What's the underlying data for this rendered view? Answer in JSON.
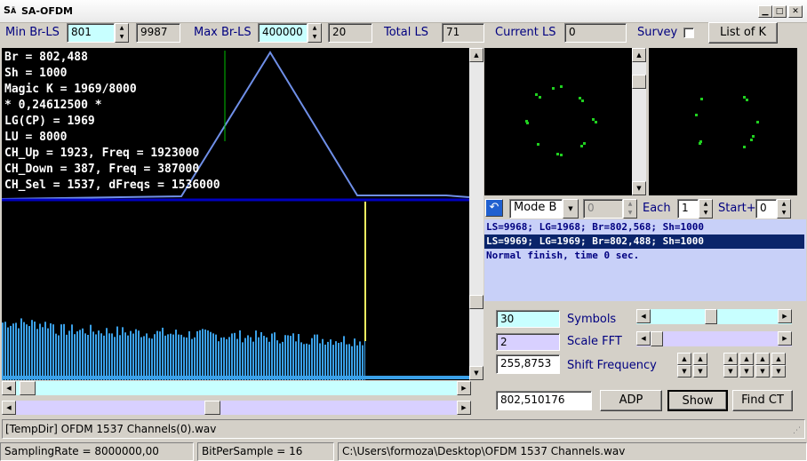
{
  "window": {
    "title": "SA-OFDM",
    "app_icon": "sa-icon",
    "controls": [
      "minimize",
      "maximize",
      "close"
    ]
  },
  "toolbar": {
    "min_br_label": "Min Br-LS",
    "min_br_value": "801",
    "min_br_aux": "9987",
    "max_br_label": "Max Br-LS",
    "max_br_value": "400000",
    "max_br_aux": "20",
    "total_ls_label": "Total LS",
    "total_ls_value": "71",
    "current_ls_label": "Current LS",
    "current_ls_value": "0",
    "survey_label": "Survey",
    "survey_checked": false,
    "list_of_k_label": "List of K"
  },
  "plot": {
    "info_lines": [
      "Br = 802,488",
      "Sh = 1000",
      "Magic K = 1969/8000",
      "* 0,24612500 *",
      "LG(CP) = 1969",
      "LU = 8000",
      "CH_Up = 1923, Freq = 1923000",
      "CH_Down = 387, Freq = 387000",
      "CH_Sel = 1537, dFreqs = 1536000"
    ],
    "colors": {
      "triangle": "#6f8fe8",
      "marker_green": "#00c000",
      "divider": "#0000c0",
      "marker_yellow": "#f0f060",
      "spectrum": "#3aa0e8"
    }
  },
  "mode_bar": {
    "mode_value": "Mode B",
    "step_value": "0",
    "each_label": "Each",
    "each_value": "1",
    "start_label": "Start+",
    "start_value": "0"
  },
  "log": {
    "lines": [
      "LS=9968; LG=1968; Br=802,568; Sh=1000",
      "LS=9969; LG=1969; Br=802,488; Sh=1000",
      "Normal finish, time 0 sec."
    ],
    "selected_index": 1
  },
  "controls": {
    "symbols_value": "30",
    "symbols_label": "Symbols",
    "symbols_slider_fraction": 0.47,
    "scale_fft_value": "2",
    "scale_fft_label": "Scale FFT",
    "scale_fft_slider_fraction": 0.0,
    "shift_value": "255,8753",
    "shift_label": "Shift Frequency",
    "result_value": "802,510176",
    "adp_label": "ADP",
    "show_label": "Show",
    "find_ct_label": "Find CT"
  },
  "file_line": "[TempDir] OFDM 1537 Channels(0).wav",
  "status": {
    "sampling_rate": "SamplingRate = 8000000,00",
    "bits": "BitPerSample = 16",
    "path": "C:\\Users\\formoza\\Desktop\\OFDM 1537 Channels.wav"
  }
}
